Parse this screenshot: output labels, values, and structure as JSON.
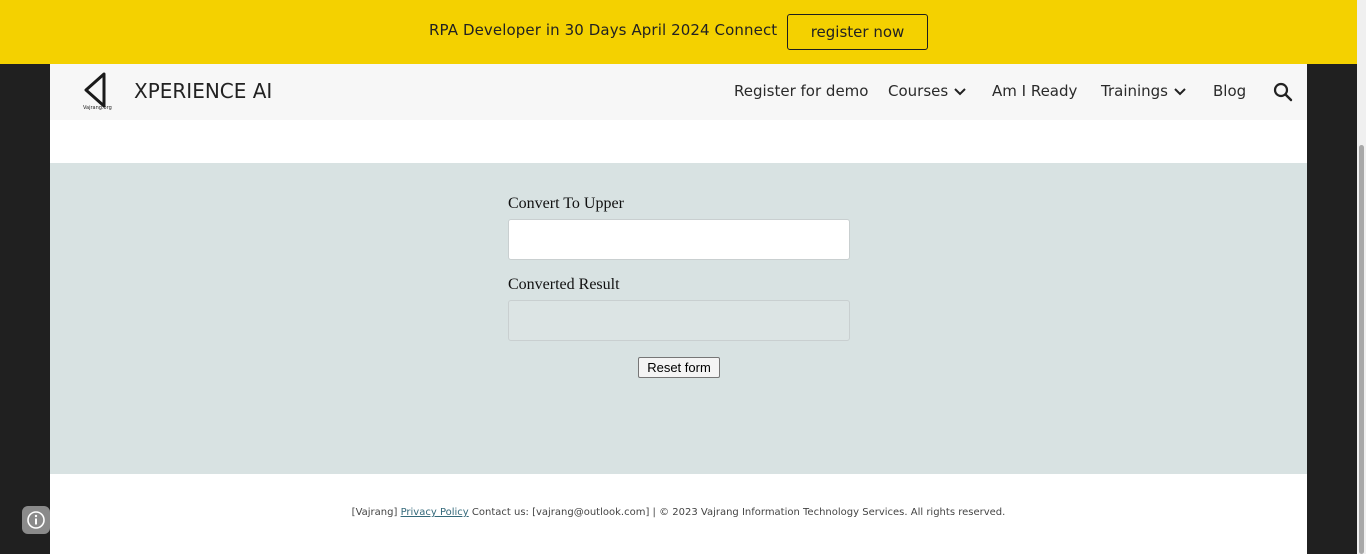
{
  "banner": {
    "text": "RPA Developer in 30 Days April 2024 Connect",
    "button_label": "register now",
    "background": "#f4d100"
  },
  "header": {
    "logo_caption": "Vajrang.org",
    "site_title": "XPERIENCE AI",
    "nav": [
      {
        "label": "Register for demo",
        "has_dropdown": false
      },
      {
        "label": "Courses",
        "has_dropdown": true
      },
      {
        "label": "Am I Ready",
        "has_dropdown": false
      },
      {
        "label": "Trainings",
        "has_dropdown": true
      },
      {
        "label": "Blog",
        "has_dropdown": false
      }
    ],
    "search_icon": "search-icon"
  },
  "form": {
    "input_label": "Convert To Upper",
    "input_value": "",
    "result_label": "Converted Result",
    "result_value": "",
    "reset_label": "Reset form",
    "section_background": "#d8e2e2"
  },
  "footer": {
    "prefix": "[Vajrang] ",
    "privacy_link": "Privacy Policy",
    "suffix": " Contact us: [vajrang@outlook.com] | © 2023 Vajrang Information Technology Services. All rights reserved."
  },
  "info_icon": "info-icon"
}
